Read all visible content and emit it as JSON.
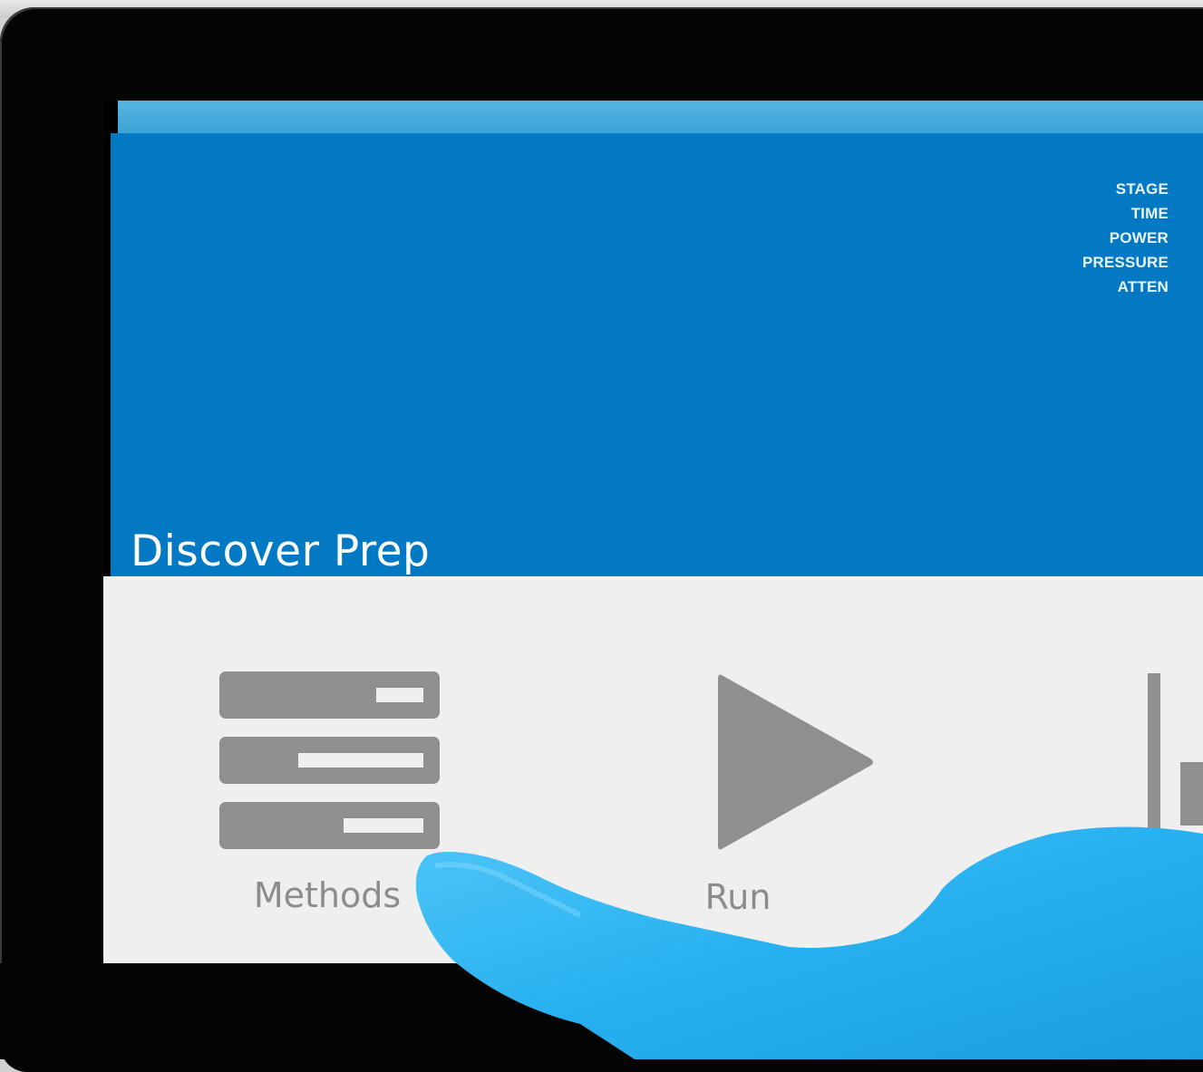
{
  "app": {
    "title": "Discover Prep"
  },
  "status": {
    "stage_label": "STAGE",
    "time_label": "TIME",
    "power_label": "POWER",
    "pressure_label": "PRESSURE",
    "atten_label": "ATTEN"
  },
  "tiles": {
    "methods_label": "Methods",
    "run_label": "Run"
  },
  "icons": {
    "methods": "methods-list-icon",
    "run": "play-icon",
    "third": "chart-icon"
  },
  "colors": {
    "header": "#0279c2",
    "header_strip": "#3aa4d6",
    "screen_background": "#efefef",
    "icon_gray": "#8f8f8f",
    "glove": "#29b6f6"
  }
}
